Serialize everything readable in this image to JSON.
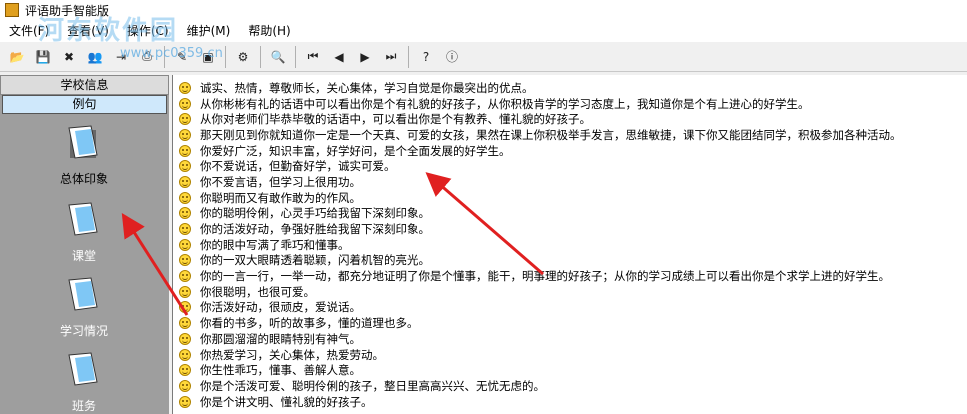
{
  "window": {
    "title": "评语助手智能版"
  },
  "watermark": {
    "text": "河东软件园",
    "url": "www.pc0359.cn"
  },
  "menu": [
    "文件(F)",
    "查看(V)",
    "操作(C)",
    "维护(M)",
    "帮助(H)"
  ],
  "toolbar": {
    "groups": [
      [
        {
          "name": "open-icon",
          "glyph": "📂"
        },
        {
          "name": "save-icon",
          "glyph": "💾"
        },
        {
          "name": "delete-icon",
          "glyph": "✖"
        },
        {
          "name": "users-icon",
          "glyph": "👥"
        },
        {
          "name": "export-icon",
          "glyph": "⇥"
        },
        {
          "name": "print-icon",
          "glyph": "⎙"
        }
      ],
      [
        {
          "name": "edit-icon",
          "glyph": "✎"
        },
        {
          "name": "view-icon",
          "glyph": "▣"
        }
      ],
      [
        {
          "name": "settings-icon",
          "glyph": "⚙"
        }
      ],
      [
        {
          "name": "find-icon",
          "glyph": "🔍"
        }
      ],
      [
        {
          "name": "first-record-icon",
          "glyph": "⏮"
        },
        {
          "name": "previous-record-icon",
          "glyph": "◀"
        },
        {
          "name": "next-record-icon",
          "glyph": "▶"
        },
        {
          "name": "last-record-icon",
          "glyph": "⏭"
        }
      ],
      [
        {
          "name": "help-icon",
          "glyph": "?"
        },
        {
          "name": "about-icon",
          "glyph": "ⓘ"
        }
      ]
    ]
  },
  "sidebar": {
    "header": "学校信息",
    "tab": "例句",
    "items": [
      {
        "label": "总体印象",
        "icon": "book-icon"
      },
      {
        "label": "课堂",
        "icon": "book-icon"
      },
      {
        "label": "学习情况",
        "icon": "book-icon"
      },
      {
        "label": "班务",
        "icon": "book-icon"
      }
    ]
  },
  "phrases": [
    "诚实、热情，尊敬师长，关心集体，学习自觉是你最突出的优点。",
    "从你彬彬有礼的话语中可以看出你是个有礼貌的好孩子，从你积极肯学的学习态度上，我知道你是个有上进心的好学生。",
    "从你对老师们毕恭毕敬的话语中，可以看出你是个有教养、懂礼貌的好孩子。",
    "那天刚见到你就知道你一定是一个天真、可爱的女孩，果然在课上你积极举手发言，思维敏捷，课下你又能团结同学，积极参加各种活动。",
    "你爱好广泛，知识丰富，好学好问，是个全面发展的好学生。",
    "你不爱说话，但勤奋好学，诚实可爱。",
    "你不爱言语，但学习上很用功。",
    "你聪明而又有敢作敢为的作风。",
    "你的聪明伶俐，心灵手巧给我留下深刻印象。",
    "你的活泼好动，争强好胜给我留下深刻印象。",
    "你的眼中写满了乖巧和懂事。",
    "你的一双大眼睛透着聪颖，闪着机智的亮光。",
    "你的一言一行，一举一动，都充分地证明了你是个懂事，能干，明事理的好孩子；从你的学习成绩上可以看出你是个求学上进的好学生。",
    "你很聪明，也很可爱。",
    "你活泼好动，很顽皮，爱说话。",
    "你看的书多，听的故事多，懂的道理也多。",
    "你那圆溜溜的眼睛特别有神气。",
    "你热爱学习，关心集体，热爱劳动。",
    "你生性乖巧，懂事、善解人意。",
    "你是个活泼可爱、聪明伶俐的孩子，整日里高高兴兴、无忧无虑的。",
    "你是个讲文明、懂礼貌的好孩子。"
  ],
  "colors": {
    "selection_tab": "#cfe8fb",
    "sidebar_bg": "#9e9e9e",
    "arrow": "#e02020"
  }
}
